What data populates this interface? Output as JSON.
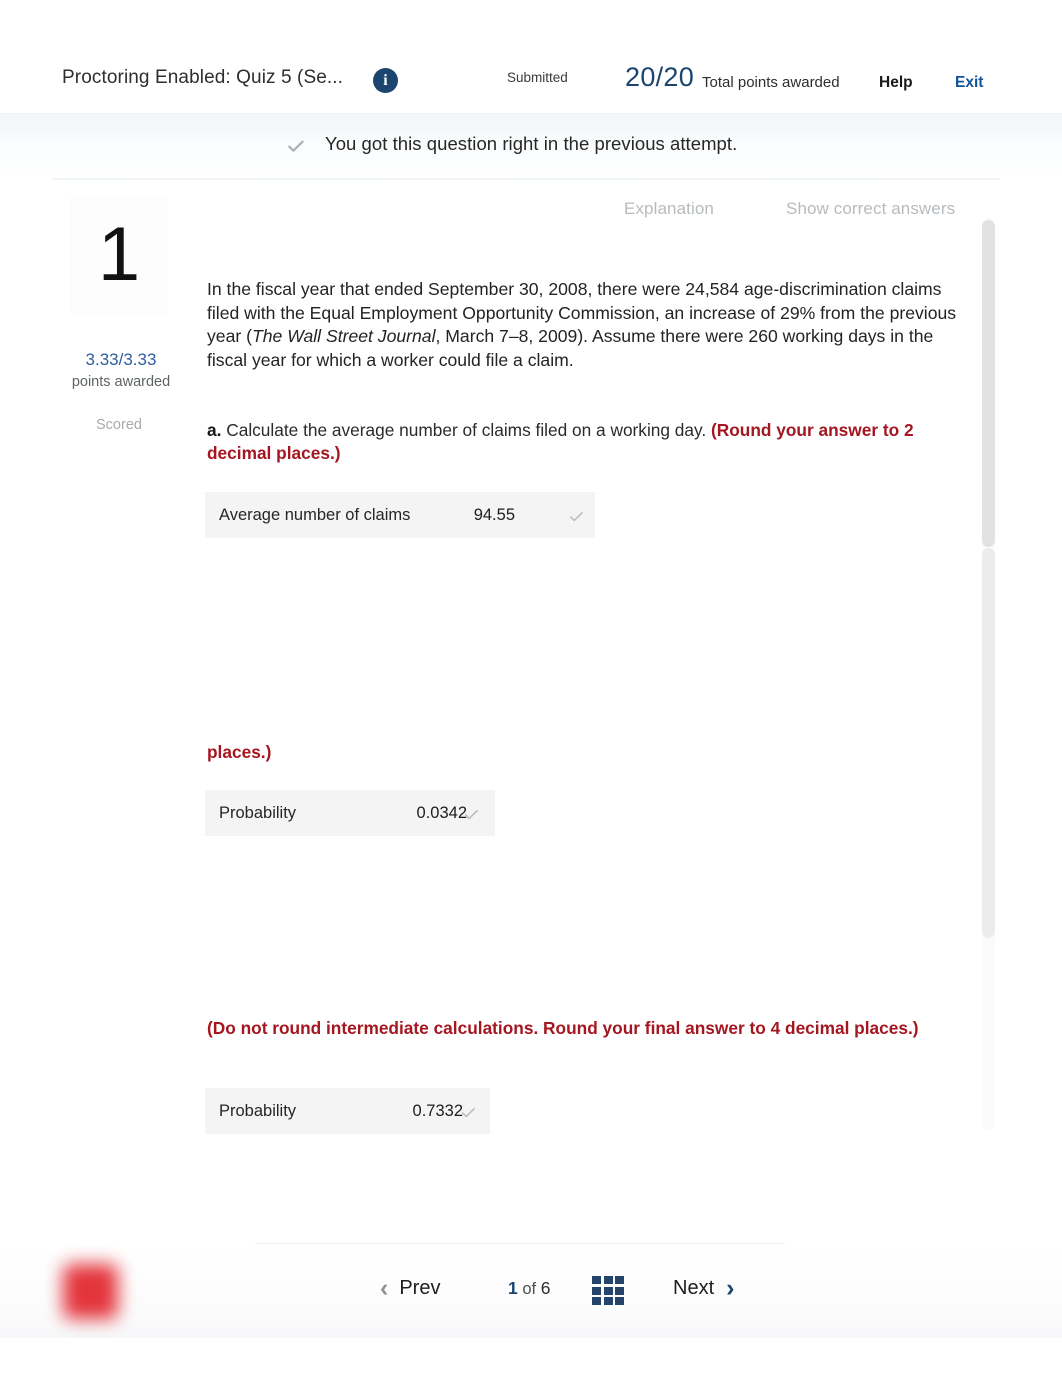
{
  "header": {
    "quiz_title": "Proctoring Enabled: Quiz 5 (Se...",
    "info_icon": "info-icon",
    "status": "Submitted",
    "points_fraction": "20/20",
    "points_label": "Total points awarded",
    "help_label": "Help",
    "exit_label": "Exit",
    "accent_blue": "#1b456f",
    "link_blue": "#12539c"
  },
  "status_banner": {
    "check_icon": "check-icon",
    "message": "You got this question right in the previous attempt."
  },
  "question": {
    "number": "1",
    "points_awarded_value": "3.33/3.33",
    "points_awarded_label": "points awarded",
    "scored_label": "Scored",
    "explanation_label": "Explanation",
    "show_correct_answers_label": "Show correct answers",
    "stem_part1": "In the fiscal year that ended September 30, 2008, there were 24,584 age-discrimination claims filed with the Equal Employment Opportunity Commission, an increase of 29% from the previous year (",
    "stem_italic": "The Wall Street Journal",
    "stem_part2": ", March 7–8, 2009). Assume there were 260 working days in the fiscal year for which a worker could file a claim.",
    "part_a_marker": "a.",
    "part_a_text": " Calculate the average number of claims filed on a working day. ",
    "part_a_instruction": "(Round your answer to 2 decimal places.)",
    "red_fragment_places": "places.)",
    "part_c_instruction": "(Do not round intermediate calculations. Round your final answer to 4 decimal places.)",
    "red_color": "#a41620"
  },
  "answers": [
    {
      "id": "ans-a",
      "label": "Average number of claims",
      "value": "94.55",
      "check_icon": "check-icon",
      "correct": true
    },
    {
      "id": "ans-b",
      "label": "Probability",
      "value": "0.0342",
      "check_icon": "check-icon",
      "correct": true
    },
    {
      "id": "ans-c",
      "label": "Probability",
      "value": "0.7332",
      "check_icon": "check-icon",
      "correct": true
    }
  ],
  "footer": {
    "prev_label": "Prev",
    "next_label": "Next",
    "page_current": "1",
    "page_of": "of",
    "page_total": "6",
    "grid_icon": "grid-view-icon",
    "prev_chevron_icon": "chevron-left-icon",
    "next_chevron_icon": "chevron-right-icon",
    "brand_logo": "mcgraw-hill-logo",
    "brand_color": "#e1232b"
  }
}
